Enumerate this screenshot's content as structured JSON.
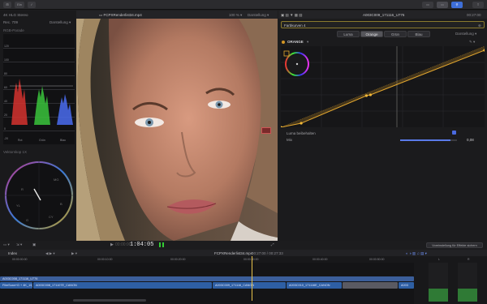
{
  "toolbar": {
    "btn1": "⊞",
    "btn2": "Ein",
    "right_btns": [
      "▭",
      "▭",
      "⚲"
    ]
  },
  "left": {
    "hdr_left": "4K HLG Stereo",
    "color_space": "Rec. 709",
    "display_label": "Darstellung",
    "rgb_parade": "RGB-Parade",
    "parade_ticks": [
      "120",
      "100",
      "80",
      "60",
      "40",
      "20",
      "0",
      "-20"
    ],
    "parade_channels": [
      "Rot",
      "Grün",
      "Blau"
    ],
    "vectorscope": "Vektorskop 1X  ",
    "vs_letters": [
      "R",
      "MG",
      "B",
      "CY",
      "G",
      "YL"
    ]
  },
  "viewer": {
    "title": "FCPXRenderlist34.mp4",
    "zoom": "100 %",
    "display": "Darstellung",
    "timecode": "1:04:05",
    "timecode_prefix": "00:00:00"
  },
  "inspector": {
    "title": "A003C009_171116_U776",
    "time": "00:27:00",
    "effect": "Farbkurven 4",
    "display": "Darstellung",
    "tabs": [
      "Luma",
      "Orange",
      "Grün",
      "Blau"
    ],
    "selected_tab": 1,
    "channel": "ORANGE",
    "luma_label": "Luma beibehalten",
    "mix_label": "Mix",
    "mix_value": "0,08",
    "mix_fraction": 0.88,
    "curve_points": [
      [
        0,
        0
      ],
      [
        0.1,
        0.05
      ],
      [
        0.42,
        0.39
      ],
      [
        0.44,
        0.4
      ],
      [
        1,
        0.95
      ]
    ]
  },
  "midbar": {
    "right_btn": "Voreinstellung für Effekte sichern"
  },
  "timeline": {
    "tab": "Index",
    "project": "FCPXRenderlist34.mp4",
    "duration": "00:27:00 / 00:27:33",
    "ticks": [
      "00:00:00:00",
      "00:00:10:00",
      "00:00:20:00",
      "00:00:30:00",
      "00:00:40:00",
      "00:00:50:00"
    ],
    "track_top": "A003C008_171116_U776",
    "clips": [
      {
        "label": "FilmScan+G + 4K_15_11"
      },
      {
        "label": "A003C008_171107E_CANON"
      },
      {
        "label": "A003C009_171116_CANON"
      },
      {
        "label": "A003C010_171116E_CANON"
      },
      {
        "label": ""
      },
      {
        "label": "A003"
      }
    ],
    "meter_labels": [
      "L",
      "R"
    ]
  },
  "colors": {
    "accent": "#e3a72f",
    "clip_blue": "#2e5fa4",
    "orange": "#d39625"
  }
}
